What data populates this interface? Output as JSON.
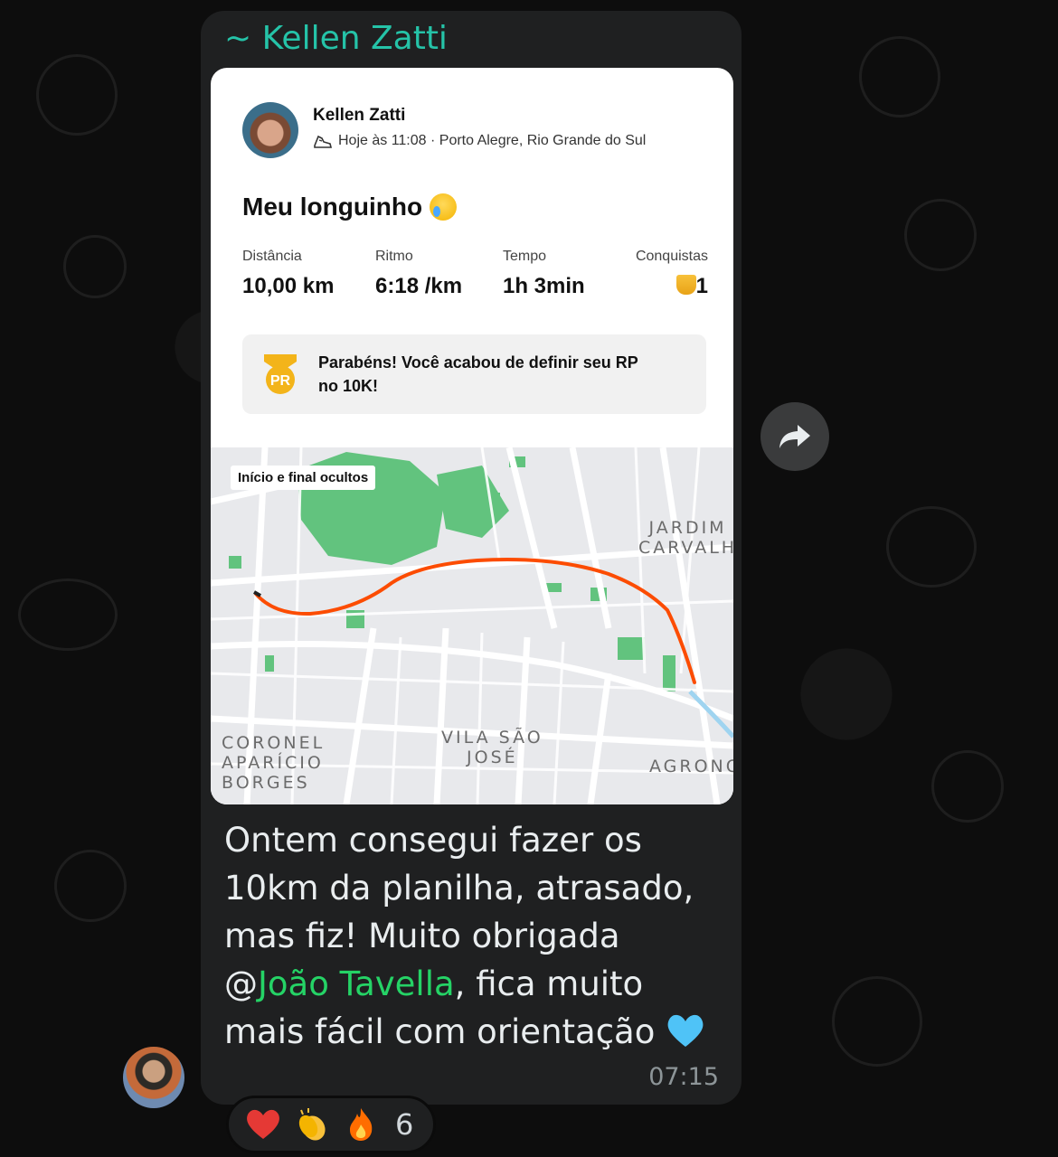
{
  "chat": {
    "sender_name": "~ Kellen Zatti",
    "message_time": "07:15",
    "message_parts": {
      "line1": "Ontem consegui fazer os",
      "line2": "10km da planilha, atrasado,",
      "line3": "mas fiz! Muito obrigada",
      "mention_at": "@",
      "mention_name": "João Tavella",
      "after_mention": ", fica muito",
      "line5": "mais fácil com orientação"
    },
    "reactions": {
      "emojis": [
        "heart-icon",
        "clap-icon",
        "fire-icon"
      ],
      "count": "6"
    }
  },
  "activity": {
    "athlete": "Kellen Zatti",
    "meta": "Hoje às 11:08 · Porto Alegre, Rio Grande do Sul",
    "title": "Meu longuinho",
    "stats": [
      {
        "label": "Distância",
        "value": "10,00 km"
      },
      {
        "label": "Ritmo",
        "value": "6:18 /km"
      },
      {
        "label": "Tempo",
        "value": "1h 3min"
      },
      {
        "label": "Conquistas",
        "value": "1"
      }
    ],
    "pr_badge": "PR",
    "pr_message": "Parabéns! Você acabou de definir seu RP no 10K!",
    "map": {
      "tag": "Início e final ocultos",
      "labels": {
        "jardim": "JARDIM\nCARVALH",
        "coronel": "CORONEL\nAPARÍCIO\nBORGES",
        "vila": "VILA SÃO\nJOSÉ",
        "agrono": "AGRONO"
      }
    }
  },
  "colors": {
    "sender": "#25c3a8",
    "mention": "#25d366",
    "route": "#fc4c02",
    "bubble": "#1f2021"
  }
}
